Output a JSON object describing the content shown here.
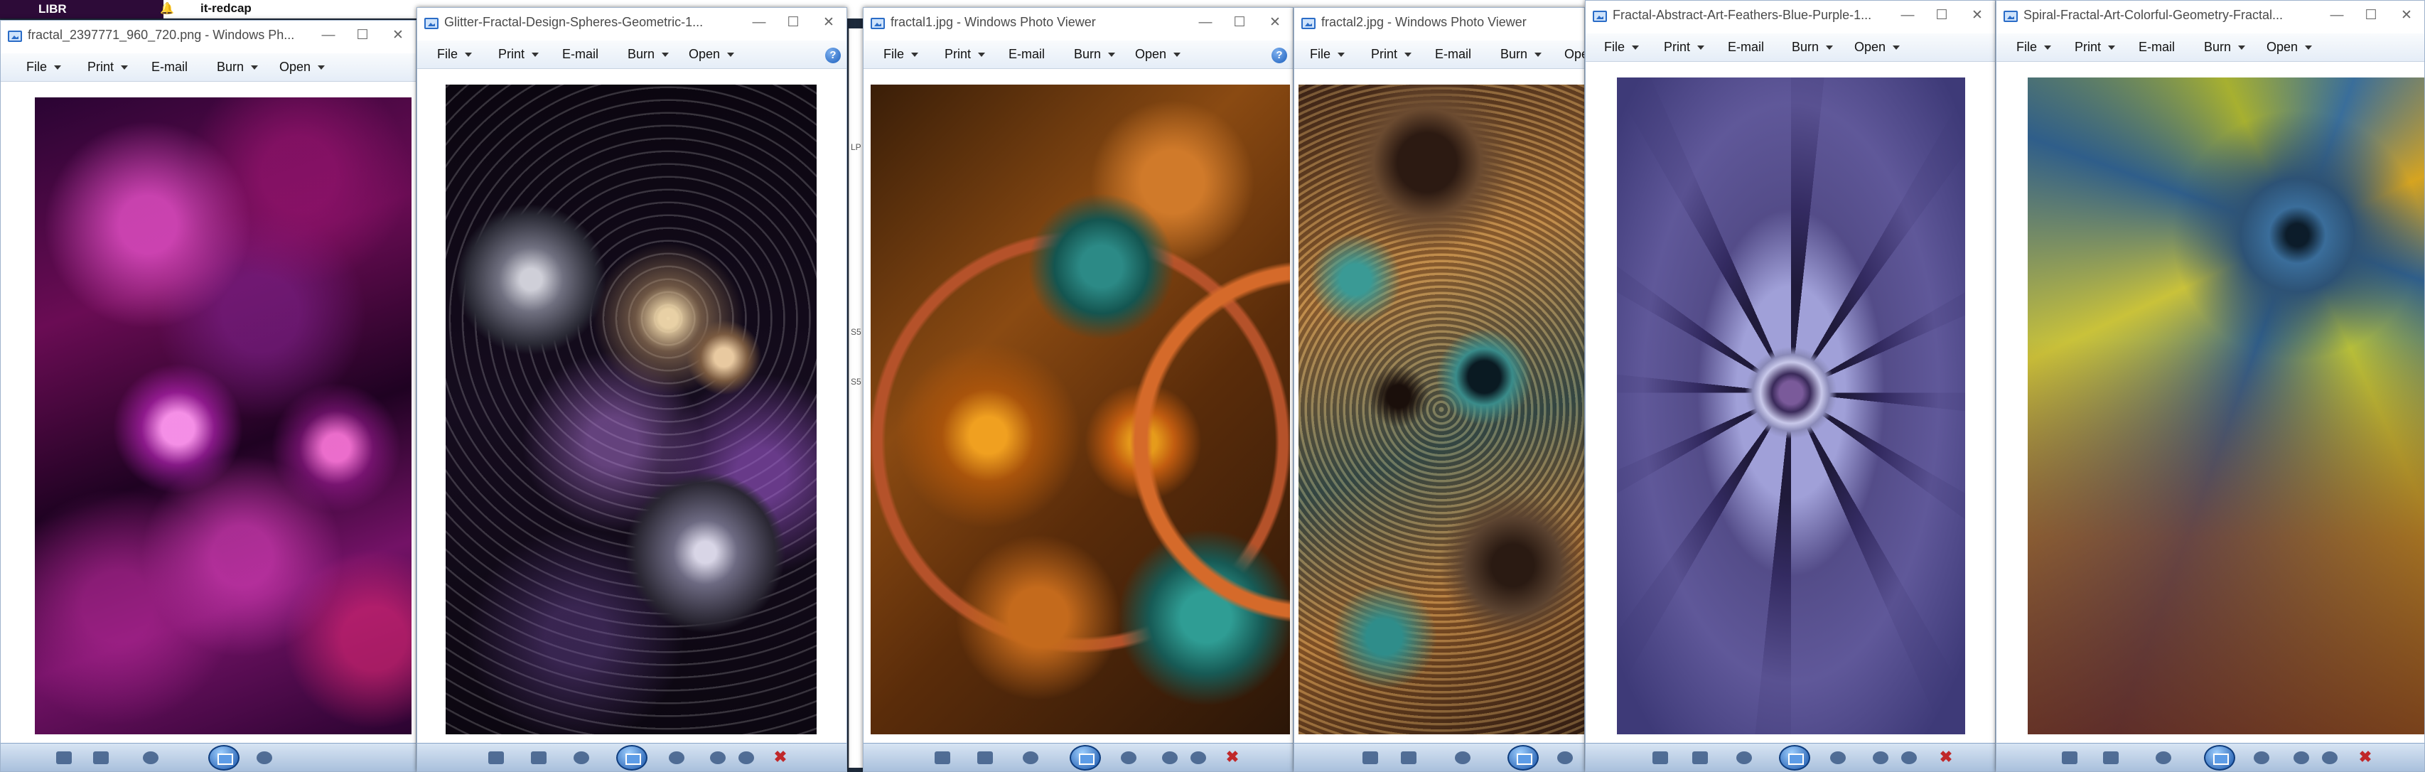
{
  "background": {
    "tab_label": "LIBR",
    "page_label": "it-redcap"
  },
  "menu_labels": {
    "file": "File",
    "print": "Print",
    "email": "E-mail",
    "burn": "Burn",
    "open": "Open",
    "help": "?"
  },
  "windows": [
    {
      "title": "fractal_2397771_960_720.png - Windows Ph..."
    },
    {
      "title": "Glitter-Fractal-Design-Spheres-Geometric-1..."
    },
    {
      "title": "fractal1.jpg - Windows Photo Viewer"
    },
    {
      "title": "fractal2.jpg - Windows Photo Viewer"
    },
    {
      "title": "Fractal-Abstract-Art-Feathers-Blue-Purple-1..."
    },
    {
      "title": "Spiral-Fractal-Art-Colorful-Geometry-Fractal..."
    }
  ],
  "icons": [
    "app-icon",
    "minimize-icon",
    "maximize-icon",
    "close-icon",
    "help-icon",
    "zoom-icon",
    "fit-icon",
    "previous-icon",
    "slideshow-icon",
    "next-icon",
    "rotate-left-icon",
    "rotate-right-icon",
    "delete-icon",
    "bell-icon"
  ],
  "colors": {
    "titlebar": "#ffffff",
    "menubar": "#e5edf7",
    "navbar": "#a9c0dc",
    "delete": "#c0282a",
    "help": "#1b5fbd"
  }
}
